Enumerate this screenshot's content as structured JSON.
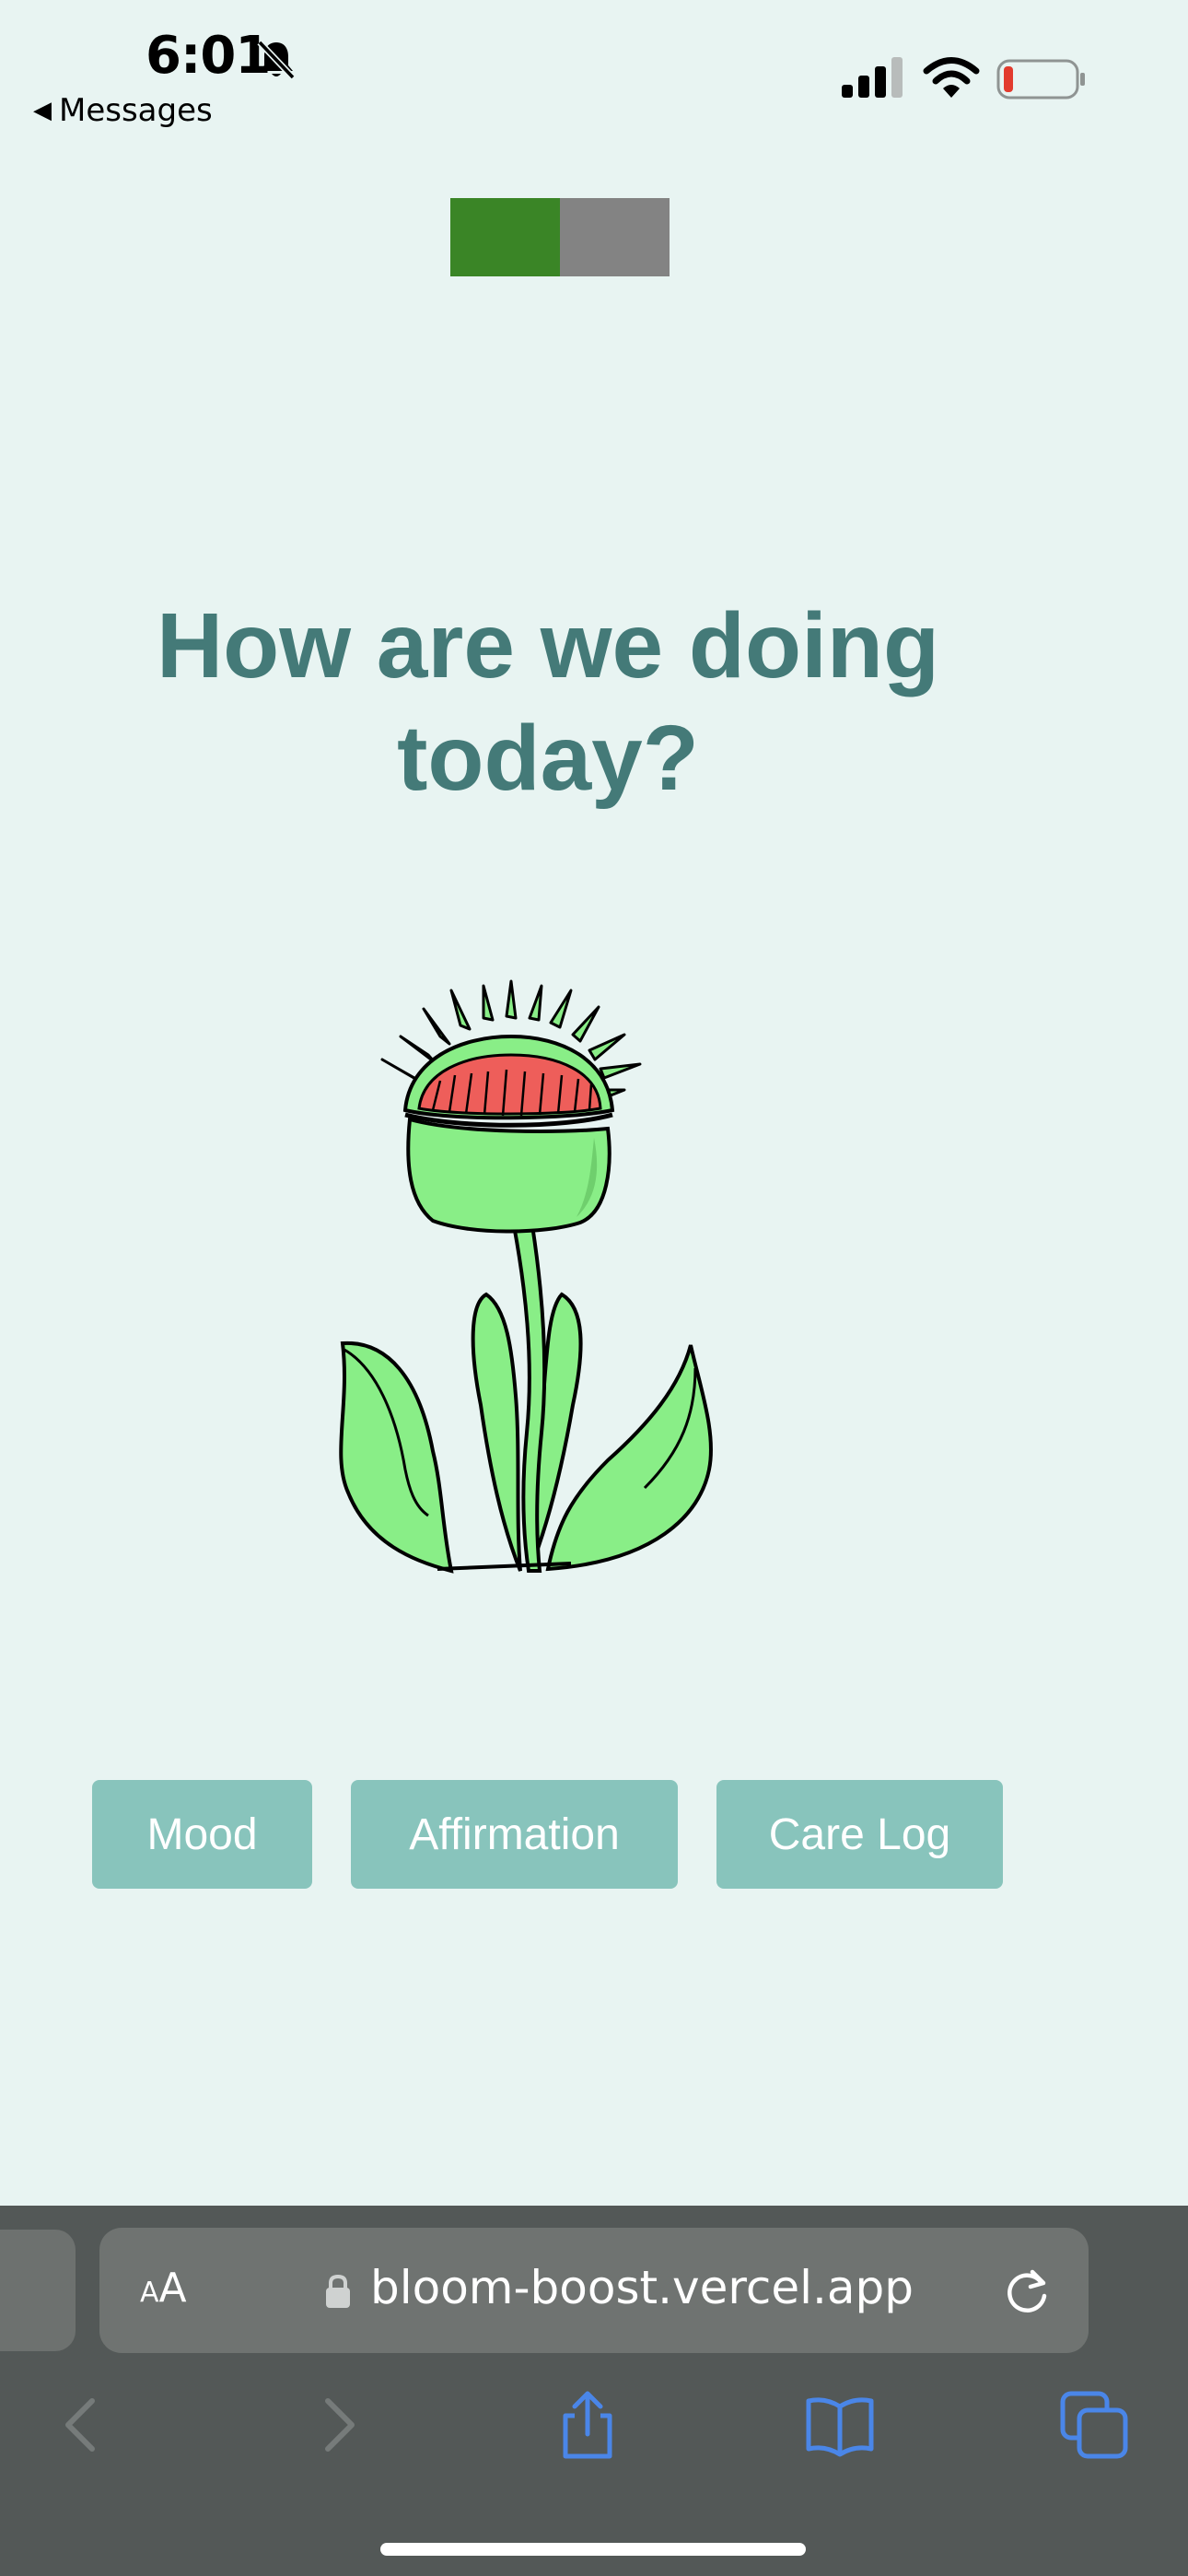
{
  "status_bar": {
    "time": "6:01",
    "back_label": "Messages",
    "icons": [
      "bell-slash-icon",
      "cellular-signal-icon",
      "wifi-icon",
      "battery-low-icon"
    ]
  },
  "progress": {
    "value": 0.5,
    "fill_color": "#3a8526",
    "track_color": "#838383"
  },
  "main": {
    "headline": "How are we doing today?",
    "illustration": "venus-flytrap-plant"
  },
  "nav_buttons": [
    {
      "label": "Mood"
    },
    {
      "label": "Affirmation"
    },
    {
      "label": "Care Log"
    }
  ],
  "browser": {
    "text_size_label_small": "A",
    "text_size_label_big": "A",
    "url": "bloom-boost.vercel.app",
    "toolbar": [
      "back-icon",
      "forward-icon",
      "share-icon",
      "bookmarks-icon",
      "tabs-icon"
    ]
  },
  "colors": {
    "background": "#e8f4f2",
    "headline": "#447a78",
    "button": "#88c4bc",
    "browser_bar": "#535857",
    "accent_blue": "#4a86e8"
  }
}
